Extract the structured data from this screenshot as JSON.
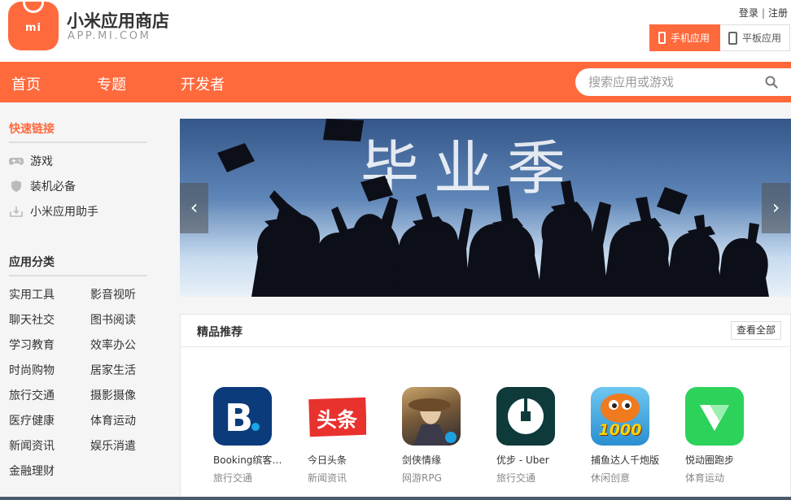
{
  "header": {
    "logo_mark": "mi",
    "brand_name": "小米应用商店",
    "brand_sub": "APP.MI.COM",
    "login": "登录",
    "separator": "|",
    "register": "注册",
    "device_tabs": [
      {
        "label": "手机应用",
        "active": true,
        "icon": "phone-icon"
      },
      {
        "label": "平板应用",
        "active": false,
        "icon": "tablet-icon"
      }
    ]
  },
  "nav": {
    "items": [
      "首页",
      "专题",
      "开发者"
    ],
    "search_placeholder": "搜索应用或游戏"
  },
  "sidebar": {
    "quick_links_title": "快速链接",
    "quick_links": [
      {
        "label": "游戏",
        "icon": "gamepad-icon"
      },
      {
        "label": "装机必备",
        "icon": "shield-icon"
      },
      {
        "label": "小米应用助手",
        "icon": "download-icon"
      }
    ],
    "categories_title": "应用分类",
    "categories": [
      "实用工具",
      "影音视听",
      "聊天社交",
      "图书阅读",
      "学习教育",
      "效率办公",
      "时尚购物",
      "居家生活",
      "旅行交通",
      "摄影摄像",
      "医疗健康",
      "体育运动",
      "新闻资讯",
      "娱乐消遣",
      "金融理财"
    ]
  },
  "banner": {
    "headline": "毕业季",
    "prev_label": "‹",
    "next_label": "›"
  },
  "recommend": {
    "title": "精品推荐",
    "view_all": "查看全部",
    "apps": [
      {
        "name": "Booking缤客酒…",
        "category": "旅行交通",
        "icon": "booking-icon"
      },
      {
        "name": "今日头条",
        "category": "新闻资讯",
        "icon": "toutiao-icon",
        "icon_text": "头条"
      },
      {
        "name": "剑侠情缘",
        "category": "网游RPG",
        "icon": "jianxia-icon"
      },
      {
        "name": "优步 - Uber",
        "category": "旅行交通",
        "icon": "uber-icon"
      },
      {
        "name": "捕鱼达人千炮版",
        "category": "休闲创意",
        "icon": "fishing-icon",
        "icon_text": "1000"
      },
      {
        "name": "悦动圈跑步",
        "category": "体育运动",
        "icon": "yuedong-icon"
      }
    ]
  },
  "colors": {
    "accent": "#ff6a3d",
    "booking": "#0c3b7c",
    "toutiao": "#e8322e",
    "uber": "#0f3a3a",
    "yuedong": "#2dd25a"
  }
}
